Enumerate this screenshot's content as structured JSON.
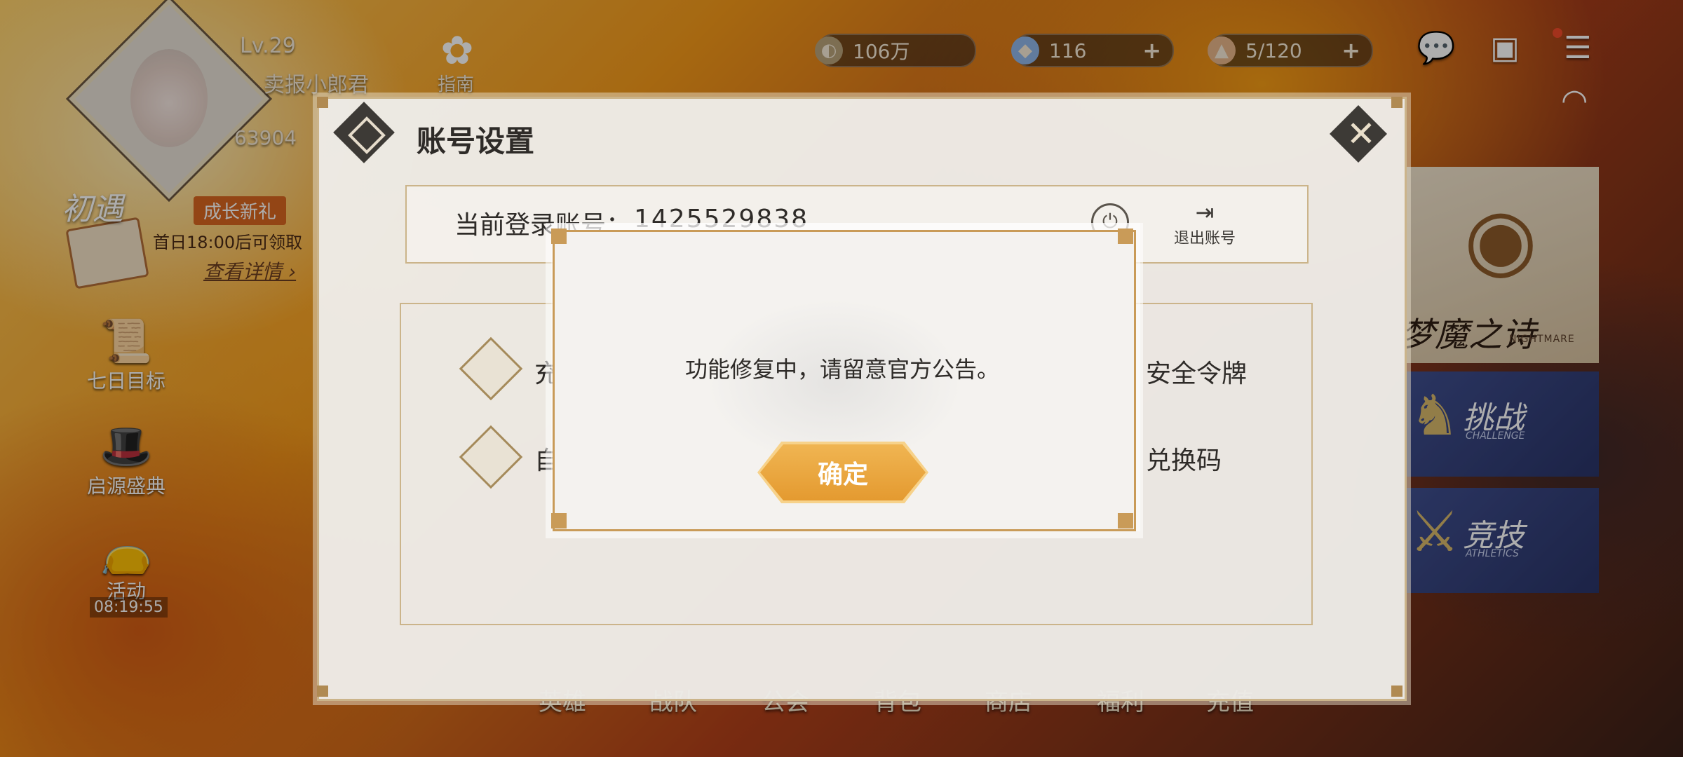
{
  "player": {
    "level": "Lv.29",
    "name": "卖报小郎君",
    "power": "63904"
  },
  "hud": {
    "guide_label": "指南",
    "gold": "106万",
    "gems": "116",
    "stamina": "5/120",
    "plus": "+"
  },
  "event": {
    "title": "初遇",
    "tag": "成长新礼",
    "note": "首日18:00后可领取",
    "detail": "查看详情 ›"
  },
  "side_menu": [
    {
      "label": "七日目标"
    },
    {
      "label": "启源盛典"
    },
    {
      "label": "活动",
      "timer": "08:19:55"
    }
  ],
  "right_menu": {
    "top_label": "梦魔之诗",
    "top_sub": "NIGHTMARE",
    "challenge": "挑战",
    "challenge_sub": "CHALLENGE",
    "athletics": "竞技",
    "athletics_sub": "ATHLETICS"
  },
  "bottom_nav": [
    "英雄",
    "战队",
    "公会",
    "背包",
    "商店",
    "福利",
    "充值"
  ],
  "settings_panel": {
    "title": "账号设置",
    "account_label": "当前登录账号：",
    "account_number": "1425529838",
    "logout_label": "退出账号",
    "options": [
      "充",
      "自",
      "安全令牌",
      "兑换码"
    ]
  },
  "modal": {
    "message": "功能修复中，请留意官方公告。",
    "confirm_label": "确定"
  }
}
